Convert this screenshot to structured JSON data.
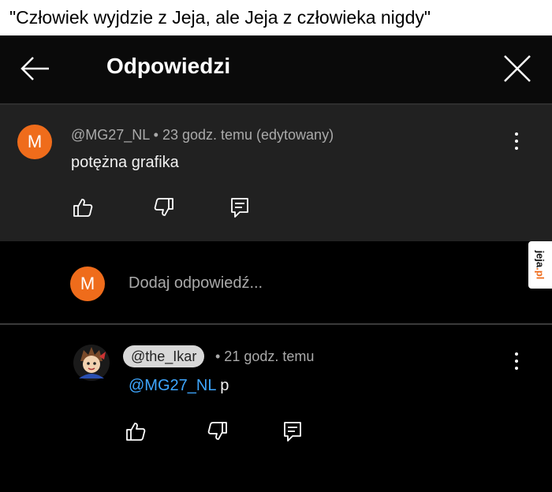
{
  "caption": "\"Człowiek wyjdzie z Jeja, ale Jeja z człowieka nigdy\"",
  "header": {
    "title": "Odpowiedzi"
  },
  "comment": {
    "avatar_letter": "M",
    "meta": "@MG27_NL • 23 godz. temu (edytowany)",
    "text": "potężna grafika"
  },
  "reply_box": {
    "avatar_letter": "M",
    "placeholder": "Dodaj odpowiedź..."
  },
  "reply": {
    "author": "@the_Ikar",
    "time": "• 21 godz. temu",
    "mention": "@MG27_NL",
    "text": "p"
  },
  "watermark": {
    "name": "jeja",
    "tld": ".pl"
  },
  "colors": {
    "accent": "#ef6c1b",
    "mention": "#3ea6ff",
    "panel": "#212121"
  },
  "icons": [
    "back-arrow-icon",
    "close-icon",
    "kebab-menu-icon",
    "like-icon",
    "dislike-icon",
    "reply-icon"
  ]
}
